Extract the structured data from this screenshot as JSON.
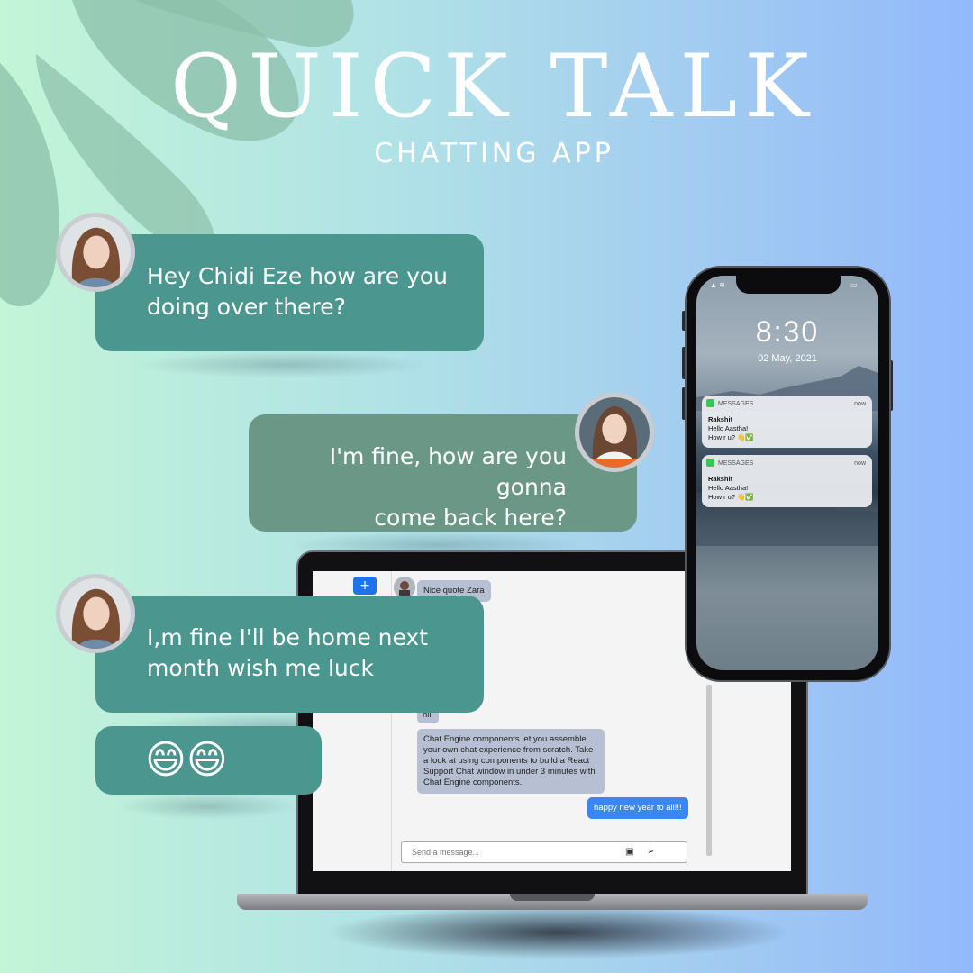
{
  "app": {
    "title": "QUICK TALK",
    "subtitle": "CHATTING APP"
  },
  "chat_bubbles": [
    {
      "text_line1": "Hey Chidi Eze how are you",
      "text_line2": "doing over there?",
      "sender": "left"
    },
    {
      "text_line1": "I'm fine, how are you gonna",
      "text_line2": "come back here?",
      "sender": "right"
    },
    {
      "text_line1": "I,m fine I'll be home next",
      "text_line2": "month wish me luck",
      "sender": "left"
    },
    {
      "text": "😄😄",
      "sender": "left"
    }
  ],
  "laptop_chat": {
    "add_button": "+",
    "messages": [
      {
        "text": "Nice quote Zara",
        "direction": "in"
      },
      {
        "text": "hiii",
        "direction": "in"
      },
      {
        "text": "Chat Engine components let you assemble your own chat experience from scratch. Take a look at using components to build a React Support Chat window in under 3 minutes with Chat Engine components.",
        "direction": "in"
      },
      {
        "text": "happy new year to all!!!",
        "direction": "out"
      }
    ],
    "input_placeholder": "Send a message...",
    "image_icon": "image-icon",
    "send_icon": "send-icon"
  },
  "phone": {
    "time": "8:30",
    "date": "02 May, 2021",
    "notifications": [
      {
        "app": "MESSAGES",
        "time": "now",
        "sender": "Rakshit",
        "line1": "Hello Aastha!",
        "line2": "How r u? 👋✅"
      },
      {
        "app": "MESSAGES",
        "time": "now",
        "sender": "Rakshit",
        "line1": "Hello Aastha!",
        "line2": "How r u? 👋✅"
      }
    ]
  },
  "colors": {
    "bubble_left": "#4b968e",
    "bubble_right": "#6b9787",
    "accent_blue": "#1e73e8",
    "message_out": "#3b86f2"
  }
}
